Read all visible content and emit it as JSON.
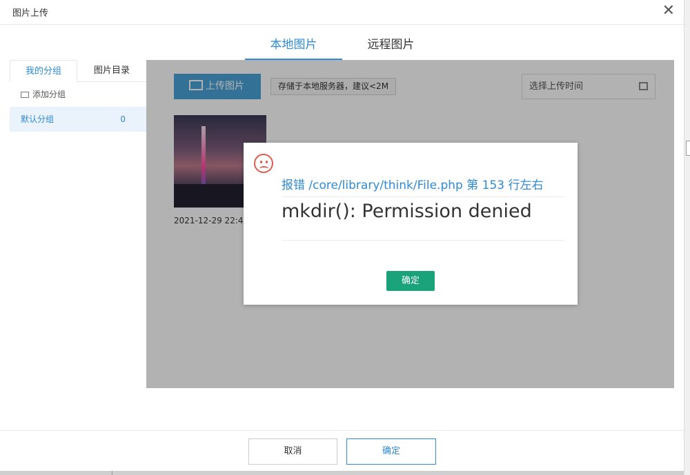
{
  "window": {
    "title": "图片上传"
  },
  "main_tabs": [
    {
      "label": "本地图片",
      "active": true
    },
    {
      "label": "远程图片",
      "active": false
    }
  ],
  "sidebar": {
    "tabs": [
      {
        "label": "我的分组",
        "active": true
      },
      {
        "label": "图片目录",
        "active": false
      }
    ],
    "add_group_label": "添加分组",
    "groups": [
      {
        "name": "默认分组",
        "count": "0"
      }
    ]
  },
  "toolbar": {
    "upload_label": "上传图片",
    "upload_tip": "存储于本地服务器，建议<2M",
    "date_placeholder": "选择上传时间"
  },
  "images": [
    {
      "date": "2021-12-29 22:4"
    }
  ],
  "footer": {
    "cancel_label": "取消",
    "confirm_label": "确定"
  },
  "error_dialog": {
    "title": "报错 /core/library/think/File.php 第 153 行左右",
    "message": "mkdir(): Permission denied",
    "ok_label": "确定"
  },
  "colors": {
    "accent": "#2e8ad6",
    "upload_button": "#4aa3d8",
    "ok_button": "#1aa37b",
    "error_icon": "#e05b4e"
  }
}
